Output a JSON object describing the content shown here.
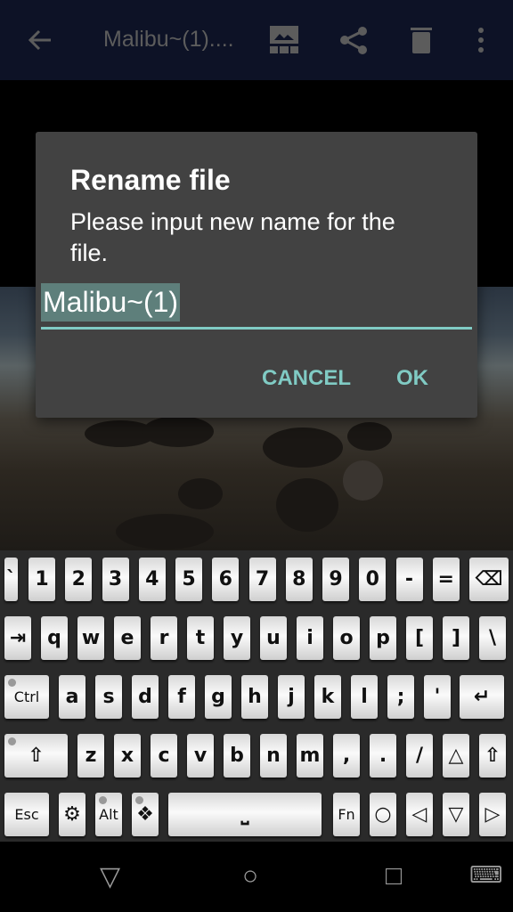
{
  "topbar": {
    "title": "Malibu~(1)....",
    "icons": [
      "back-arrow-icon",
      "gallery-icon",
      "share-icon",
      "delete-icon",
      "more-vert-icon"
    ]
  },
  "dialog": {
    "title": "Rename file",
    "message": "Please input new name for the file.",
    "input_value": "Malibu~(1)",
    "cancel": "CANCEL",
    "ok": "OK",
    "accent": "#80cbc4"
  },
  "keyboard": {
    "rows": [
      [
        "`",
        "1",
        "2",
        "3",
        "4",
        "5",
        "6",
        "7",
        "8",
        "9",
        "0",
        "-",
        "=",
        "⌫"
      ],
      [
        "⇥",
        "q",
        "w",
        "e",
        "r",
        "t",
        "y",
        "u",
        "i",
        "o",
        "p",
        "[",
        "]",
        "\\"
      ],
      [
        "Ctrl",
        "a",
        "s",
        "d",
        "f",
        "g",
        "h",
        "j",
        "k",
        "l",
        ";",
        "'",
        "↵"
      ],
      [
        "⇧",
        "z",
        "x",
        "c",
        "v",
        "b",
        "n",
        "m",
        ",",
        ".",
        "/",
        "△",
        "⇧"
      ],
      [
        "Esc",
        "⚙",
        "Alt",
        "❖",
        "␣",
        "Fn",
        "○",
        "◁",
        "▽",
        "▷"
      ]
    ]
  },
  "navbar": {
    "back": "▽",
    "home": "○",
    "recents": "□",
    "keyboard": "⌨"
  }
}
